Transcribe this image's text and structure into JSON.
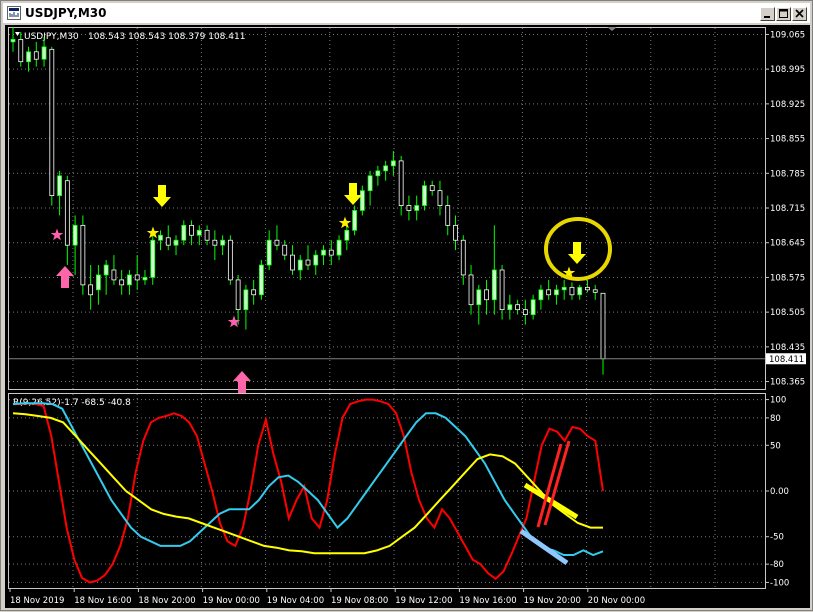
{
  "window": {
    "title": "USDJPY,M30"
  },
  "main_header": {
    "symbol": "USDJPY,M30",
    "ohlc": "108.543 108.543 108.379 108.411"
  },
  "indicator_header": {
    "name": "R(9,26,52)",
    "values": "-1.7 -68.5 -40.8"
  },
  "colors": {
    "background": "#000000",
    "grid": "#7a7a7a",
    "frame": "#c8c8c8",
    "bull_candle": "#ccffcc",
    "bear_candle": "#ffffff",
    "wick": "#00ff00",
    "line_red": "#ff0000",
    "line_cyan": "#33ccee",
    "line_yellow": "#ffff00",
    "arrow_yellow": "#ffff00",
    "arrow_pink": "#ff66aa",
    "star_yellow": "#ffee00",
    "star_pink": "#ff5faf",
    "highlight_circle": "#e8d800",
    "manual_red": "#ff2222",
    "manual_yellow": "#ffff00",
    "manual_blue": "#8ec8ff"
  },
  "price_axis": {
    "labels": [
      "109.065",
      "108.995",
      "108.925",
      "108.855",
      "108.785",
      "108.715",
      "108.645",
      "108.575",
      "108.505",
      "108.435",
      "108.365"
    ],
    "current_price": "108.411"
  },
  "indicator_axis": {
    "labels": [
      "100",
      "80",
      "50",
      "0.00",
      "-50",
      "-80",
      "-100"
    ]
  },
  "time_axis": {
    "labels": [
      "18 Nov 2019",
      "18 Nov 16:00",
      "18 Nov 20:00",
      "19 Nov 00:00",
      "19 Nov 04:00",
      "19 Nov 08:00",
      "19 Nov 12:00",
      "19 Nov 16:00",
      "19 Nov 20:00",
      "20 Nov 00:00"
    ]
  },
  "chart_data": {
    "type": "candlestick",
    "symbol": "USDJPY",
    "timeframe": "M30",
    "ylim": [
      108.35,
      109.08
    ],
    "candles": [
      [
        109.05,
        109.08,
        109.03,
        109.055
      ],
      [
        109.055,
        109.07,
        109.0,
        109.01
      ],
      [
        109.01,
        109.04,
        108.99,
        109.03
      ],
      [
        109.03,
        109.05,
        109.0,
        109.015
      ],
      [
        109.015,
        109.06,
        109.0,
        109.04
      ],
      [
        109.035,
        109.04,
        108.72,
        108.74
      ],
      [
        108.74,
        108.79,
        108.7,
        108.78
      ],
      [
        108.77,
        108.78,
        108.6,
        108.64
      ],
      [
        108.64,
        108.7,
        108.58,
        108.68
      ],
      [
        108.68,
        108.7,
        108.54,
        108.56
      ],
      [
        108.56,
        108.6,
        108.51,
        108.54
      ],
      [
        108.55,
        108.6,
        108.52,
        108.58
      ],
      [
        108.58,
        108.61,
        108.54,
        108.6
      ],
      [
        108.59,
        108.62,
        108.56,
        108.57
      ],
      [
        108.57,
        108.59,
        108.54,
        108.56
      ],
      [
        108.56,
        108.59,
        108.54,
        108.58
      ],
      [
        108.58,
        108.62,
        108.55,
        108.57
      ],
      [
        108.57,
        108.59,
        108.56,
        108.575
      ],
      [
        108.575,
        108.66,
        108.56,
        108.65
      ],
      [
        108.65,
        108.67,
        108.63,
        108.66
      ],
      [
        108.655,
        108.68,
        108.63,
        108.64
      ],
      [
        108.64,
        108.66,
        108.62,
        108.65
      ],
      [
        108.65,
        108.69,
        108.64,
        108.68
      ],
      [
        108.68,
        108.69,
        108.64,
        108.66
      ],
      [
        108.66,
        108.68,
        108.64,
        108.67
      ],
      [
        108.67,
        108.68,
        108.64,
        108.65
      ],
      [
        108.65,
        108.67,
        108.61,
        108.64
      ],
      [
        108.64,
        108.66,
        108.62,
        108.65
      ],
      [
        108.65,
        108.66,
        108.56,
        108.57
      ],
      [
        108.57,
        108.58,
        108.48,
        108.51
      ],
      [
        108.51,
        108.56,
        108.47,
        108.55
      ],
      [
        108.55,
        108.57,
        108.52,
        108.54
      ],
      [
        108.54,
        108.61,
        108.53,
        108.6
      ],
      [
        108.6,
        108.67,
        108.59,
        108.65
      ],
      [
        108.65,
        108.68,
        108.63,
        108.64
      ],
      [
        108.64,
        108.65,
        108.61,
        108.62
      ],
      [
        108.62,
        108.64,
        108.58,
        108.59
      ],
      [
        108.59,
        108.62,
        108.57,
        108.61
      ],
      [
        108.61,
        108.64,
        108.59,
        108.6
      ],
      [
        108.6,
        108.63,
        108.58,
        108.62
      ],
      [
        108.62,
        108.64,
        108.6,
        108.63
      ],
      [
        108.63,
        108.65,
        108.6,
        108.62
      ],
      [
        108.62,
        108.66,
        108.61,
        108.65
      ],
      [
        108.65,
        108.69,
        108.63,
        108.67
      ],
      [
        108.67,
        108.72,
        108.66,
        108.71
      ],
      [
        108.71,
        108.76,
        108.7,
        108.75
      ],
      [
        108.75,
        108.79,
        108.72,
        108.78
      ],
      [
        108.78,
        108.8,
        108.76,
        108.79
      ],
      [
        108.79,
        108.81,
        108.77,
        108.8
      ],
      [
        108.8,
        108.83,
        108.78,
        108.81
      ],
      [
        108.81,
        108.82,
        108.7,
        108.72
      ],
      [
        108.72,
        108.74,
        108.69,
        108.71
      ],
      [
        108.71,
        108.74,
        108.69,
        108.72
      ],
      [
        108.72,
        108.77,
        108.71,
        108.76
      ],
      [
        108.76,
        108.77,
        108.74,
        108.75
      ],
      [
        108.75,
        108.77,
        108.7,
        108.72
      ],
      [
        108.72,
        108.74,
        108.66,
        108.68
      ],
      [
        108.68,
        108.7,
        108.63,
        108.65
      ],
      [
        108.65,
        108.66,
        108.56,
        108.58
      ],
      [
        108.58,
        108.6,
        108.5,
        108.52
      ],
      [
        108.52,
        108.56,
        108.48,
        108.55
      ],
      [
        108.55,
        108.57,
        108.5,
        108.53
      ],
      [
        108.53,
        108.68,
        108.5,
        108.59
      ],
      [
        108.59,
        108.6,
        108.49,
        108.51
      ],
      [
        108.51,
        108.54,
        108.49,
        108.52
      ],
      [
        108.52,
        108.53,
        108.5,
        108.51
      ],
      [
        108.51,
        108.53,
        108.48,
        108.5
      ],
      [
        108.5,
        108.54,
        108.49,
        108.53
      ],
      [
        108.53,
        108.56,
        108.51,
        108.55
      ],
      [
        108.55,
        108.57,
        108.53,
        108.54
      ],
      [
        108.54,
        108.56,
        108.52,
        108.55
      ],
      [
        108.55,
        108.57,
        108.53,
        108.555
      ],
      [
        108.555,
        108.565,
        108.53,
        108.54
      ],
      [
        108.54,
        108.56,
        108.53,
        108.555
      ],
      [
        108.555,
        108.57,
        108.545,
        108.55
      ],
      [
        108.55,
        108.56,
        108.53,
        108.545
      ],
      [
        108.543,
        108.543,
        108.379,
        108.411
      ]
    ],
    "series": [
      {
        "values": [
          95,
          95,
          96,
          95,
          93,
          60,
          10,
          -40,
          -75,
          -95,
          -100,
          -98,
          -92,
          -80,
          -60,
          -30,
          20,
          55,
          75,
          80,
          82,
          85,
          82,
          75,
          60,
          30,
          0,
          -35,
          -55,
          -60,
          -40,
          0,
          50,
          78,
          40,
          10,
          -30,
          -10,
          5,
          -30,
          -40,
          -10,
          40,
          80,
          95,
          98,
          100,
          100,
          98,
          95,
          85,
          60,
          20,
          -10,
          -30,
          -40,
          -20,
          -30,
          -45,
          -60,
          -75,
          -80,
          -90,
          -96,
          -88,
          -70,
          -50,
          -30,
          10,
          50,
          68,
          65,
          55,
          70,
          68,
          60,
          55,
          0
        ]
      },
      {
        "values": [
          95,
          96,
          96,
          96,
          95,
          90,
          70,
          50,
          30,
          10,
          -10,
          -25,
          -40,
          -50,
          -55,
          -60,
          -60,
          -60,
          -55,
          -45,
          -35,
          -25,
          -20,
          -20,
          -20,
          -10,
          5,
          15,
          17,
          10,
          0,
          -10,
          -25,
          -40,
          -30,
          -15,
          0,
          15,
          30,
          45,
          60,
          75,
          85,
          85,
          80,
          70,
          60,
          45,
          30,
          10,
          -10,
          -25,
          -40,
          -55,
          -62,
          -65,
          -70,
          -70,
          -65,
          -70,
          -66
        ]
      },
      {
        "values": [
          85,
          84,
          82,
          80,
          75,
          60,
          45,
          30,
          15,
          0,
          -10,
          -20,
          -25,
          -28,
          -30,
          -35,
          -40,
          -45,
          -50,
          -55,
          -60,
          -62,
          -65,
          -66,
          -68,
          -68,
          -68,
          -68,
          -68,
          -65,
          -60,
          -50,
          -40,
          -25,
          -10,
          5,
          20,
          35,
          40,
          38,
          30,
          15,
          0,
          -15,
          -25,
          -35,
          -40,
          -40
        ]
      }
    ],
    "indicator_ylim": [
      -105,
      105
    ],
    "annotations": [
      {
        "type": "arrow-up",
        "color": "pink",
        "candle": 7
      },
      {
        "type": "arrow-down",
        "color": "yellow",
        "candle": 18
      },
      {
        "type": "arrow-up",
        "color": "pink",
        "candle": 29
      },
      {
        "type": "arrow-down",
        "color": "yellow",
        "candle": 44
      },
      {
        "type": "arrow-down",
        "color": "yellow",
        "candle": 72
      }
    ],
    "grid": true
  }
}
